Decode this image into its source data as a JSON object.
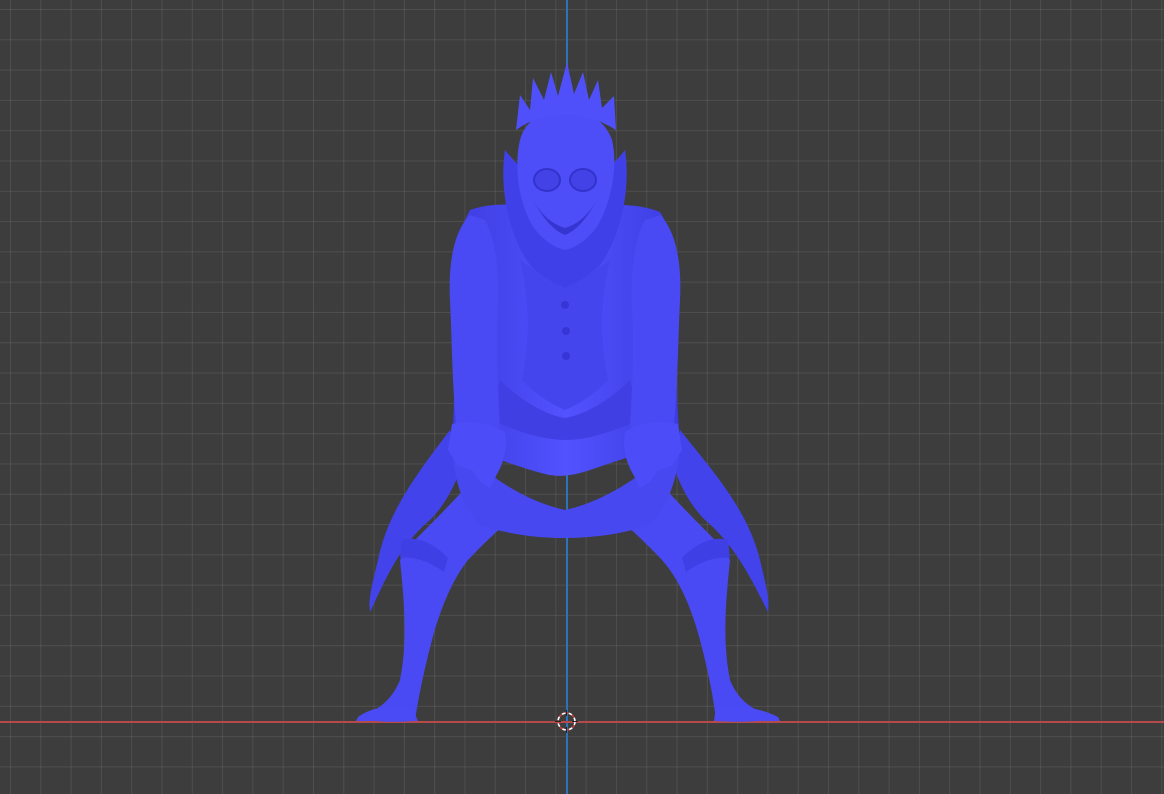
{
  "viewport": {
    "background_color": "#3d3d3d",
    "grid_color": "#4a4a4a",
    "x_axis_color": "#b64a4a",
    "z_axis_color": "#2e73b8"
  },
  "model": {
    "mesh_color": "#4d4df5",
    "shade_color": "#3a3ad8",
    "highlight_color": "#6b6bff"
  },
  "cursor_3d": {
    "icon": "3d-cursor-icon"
  }
}
